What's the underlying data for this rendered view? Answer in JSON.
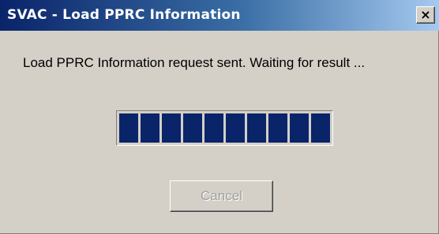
{
  "window": {
    "title": "SVAC - Load PPRC Information",
    "close_glyph": "×"
  },
  "dialog": {
    "message": "Load PPRC Information  request sent. Waiting for result ...",
    "progress": {
      "fraction": 1.0,
      "segments": 10
    },
    "cancel_label": "Cancel",
    "cancel_enabled": false
  },
  "colors": {
    "progress_fill": "#0a246a",
    "title_bar_start": "#0a246a",
    "title_bar_end": "#a6caf0",
    "dialog_face": "#d4d0c8"
  }
}
